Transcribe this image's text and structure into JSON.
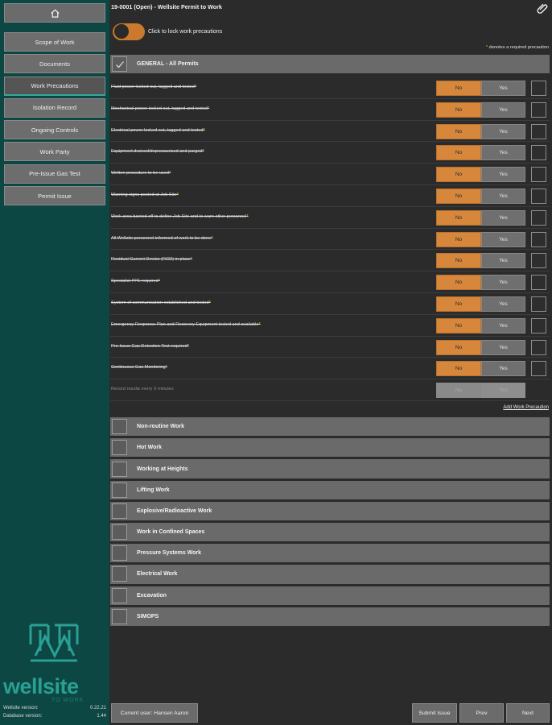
{
  "header": {
    "title": "19-0001 (Open)  -  Wellsite Permit to Work"
  },
  "toggle": {
    "label": "Click to lock work precautions"
  },
  "required_note": {
    "star": "*",
    "text": " denotes a required precaution"
  },
  "sidebar": {
    "items": [
      {
        "label": "Scope of Work"
      },
      {
        "label": "Documents"
      },
      {
        "label": "Work Precautions"
      },
      {
        "label": "Isolation Record"
      },
      {
        "label": "Ongoing Controls"
      },
      {
        "label": "Work Party"
      },
      {
        "label": "Pre-Issue Gas Test"
      },
      {
        "label": "Permit Issue"
      }
    ],
    "active_index": 2,
    "logo": {
      "word": "wellsite",
      "tagline": "TO WORK"
    },
    "versions": {
      "wellsite_label": "Wellsite version:",
      "wellsite_value": "0.22.21",
      "database_label": "Database version:",
      "database_value": "1.44"
    }
  },
  "general": {
    "title": "GENERAL - All Permits"
  },
  "precautions": {
    "no_label": "No",
    "yes_label": "Yes",
    "items": [
      {
        "text": "Fluid power locked out, tagged and tested"
      },
      {
        "text": "Mechanical power locked out, tagged and tested"
      },
      {
        "text": "Electrical power locked out, tagged and tested"
      },
      {
        "text": "Equipment drained/depressurised and purged"
      },
      {
        "text": "Written procedure to be used"
      },
      {
        "text": "Warning signs posted at Job Site"
      },
      {
        "text": "Work area barried off to define Job Site and to warn other personnel"
      },
      {
        "text": "All Wellsite personnel informed of work to be done"
      },
      {
        "text": "Residual Current Device (RCD) in place"
      },
      {
        "text": "Specialist PPE required"
      },
      {
        "text": "System of communication established and tested"
      },
      {
        "text": "Emergency Response Plan and Recovery Equipment tested and available"
      },
      {
        "text": "Pre-Issue Gas Detection Test required"
      },
      {
        "text": "Continuous Gas Monitoring"
      }
    ],
    "record_row": {
      "text": "Record results every X minutes"
    },
    "add_link": "Add Work Precaution"
  },
  "sections": [
    {
      "title": "Non-routine Work"
    },
    {
      "title": "Hot Work"
    },
    {
      "title": "Working at Heights"
    },
    {
      "title": "Lifting Work"
    },
    {
      "title": "Explosive/Radioactive Work"
    },
    {
      "title": "Work in Confined Spaces"
    },
    {
      "title": "Pressure Systems Work"
    },
    {
      "title": "Electrical Work"
    },
    {
      "title": "Excavation"
    },
    {
      "title": "SIMOPS"
    }
  ],
  "footer": {
    "current_user": "Current user: Hansen Aaron",
    "submit": "Submit Issue",
    "prev": "Prev",
    "next": "Next"
  },
  "colors": {
    "sidebar_bg": "#0c4743",
    "accent_orange": "#d6873c",
    "accent_teal": "#2a9f94"
  }
}
